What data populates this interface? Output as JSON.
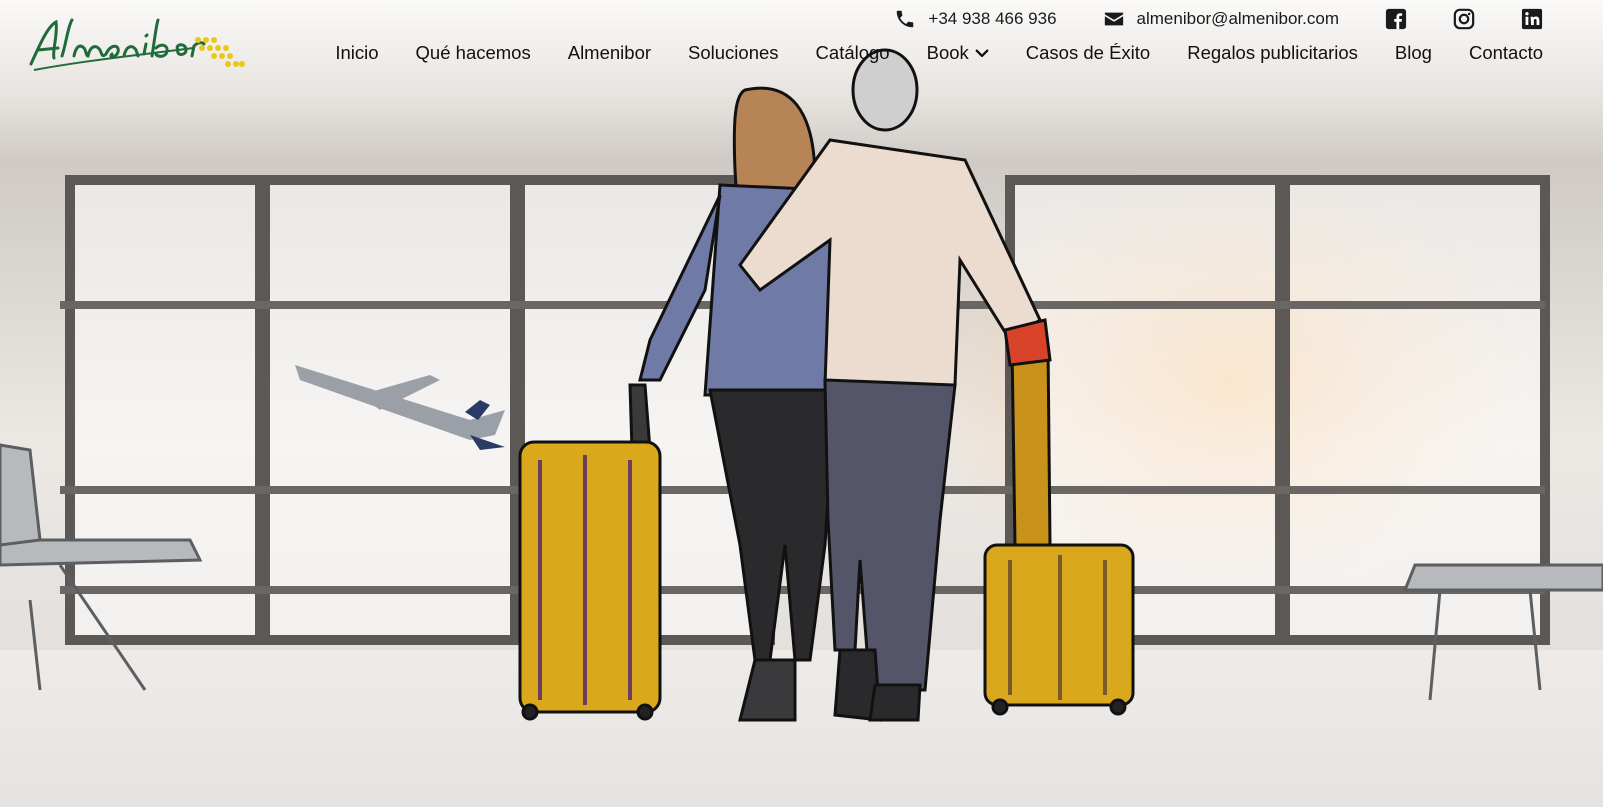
{
  "brand": {
    "name": "Almenibor"
  },
  "topbar": {
    "phone": "+34 938 466 936",
    "email": "almenibor@almenibor.com",
    "social": [
      "facebook-icon",
      "instagram-icon",
      "linkedin-icon"
    ]
  },
  "nav": {
    "items": [
      {
        "label": "Inicio"
      },
      {
        "label": "Qué hacemos"
      },
      {
        "label": "Almenibor"
      },
      {
        "label": "Soluciones"
      },
      {
        "label": "Catálogo"
      },
      {
        "label": "Book",
        "has_dropdown": true
      },
      {
        "label": "Casos de Éxito"
      },
      {
        "label": "Regalos publicitarios"
      },
      {
        "label": "Blog"
      },
      {
        "label": "Contacto"
      }
    ]
  },
  "hero": {
    "image": "couple-with-yellow-suitcases-at-airport-window-illustration"
  },
  "colors": {
    "logo_green": "#1f6b3a",
    "logo_yellow": "#e8c81a",
    "suitcase_yellow": "#d9a81c",
    "text_dark": "#111111"
  }
}
